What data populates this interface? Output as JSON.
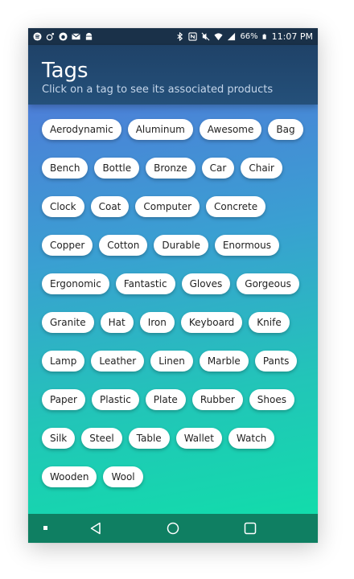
{
  "status_bar": {
    "battery_pct": "66%",
    "time": "11:07 PM",
    "left_icons": [
      "spotify-icon",
      "cast-icon",
      "bug-icon",
      "mail-icon",
      "android-icon"
    ],
    "right_icons": [
      "bluetooth-icon",
      "nfc-icon",
      "mute-icon",
      "wifi-icon",
      "signal-icon",
      "battery-icon"
    ]
  },
  "header": {
    "title": "Tags",
    "subtitle": "Click on a tag to see its associated products"
  },
  "tags": [
    "Aerodynamic",
    "Aluminum",
    "Awesome",
    "Bag",
    "Bench",
    "Bottle",
    "Bronze",
    "Car",
    "Chair",
    "Clock",
    "Coat",
    "Computer",
    "Concrete",
    "Copper",
    "Cotton",
    "Durable",
    "Enormous",
    "Ergonomic",
    "Fantastic",
    "Gloves",
    "Gorgeous",
    "Granite",
    "Hat",
    "Iron",
    "Keyboard",
    "Knife",
    "Lamp",
    "Leather",
    "Linen",
    "Marble",
    "Pants",
    "Paper",
    "Plastic",
    "Plate",
    "Rubber",
    "Shoes",
    "Silk",
    "Steel",
    "Table",
    "Wallet",
    "Watch",
    "Wooden",
    "Wool"
  ],
  "colors": {
    "header_bg": "#1f4268",
    "status_bg": "#1a3149",
    "nav_bg": "#0f7f62",
    "gradient_top": "#4d7fd8",
    "gradient_bottom": "#12dcab"
  }
}
